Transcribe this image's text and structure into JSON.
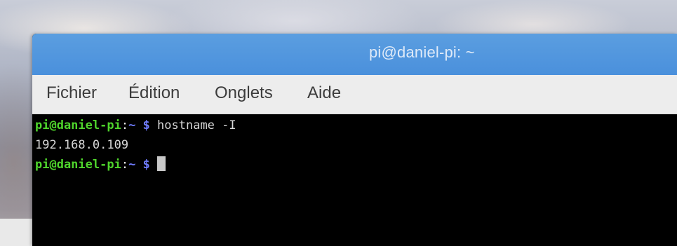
{
  "window": {
    "title": "pi@daniel-pi: ~"
  },
  "menubar": {
    "items": [
      "Fichier",
      "Édition",
      "Onglets",
      "Aide"
    ]
  },
  "terminal": {
    "lines": [
      {
        "user": "pi@daniel-pi",
        "colon": ":",
        "path": "~ $",
        "command": " hostname -I"
      },
      {
        "output": "192.168.0.109"
      },
      {
        "user": "pi@daniel-pi",
        "colon": ":",
        "path": "~ $",
        "command": " "
      }
    ],
    "colors": {
      "user": "#4fd52c",
      "path": "#6f7cff",
      "text": "#d8d8d8",
      "background": "#000000"
    }
  },
  "theme": {
    "titlebar": "#4a90dc",
    "menubar": "#ededed"
  }
}
